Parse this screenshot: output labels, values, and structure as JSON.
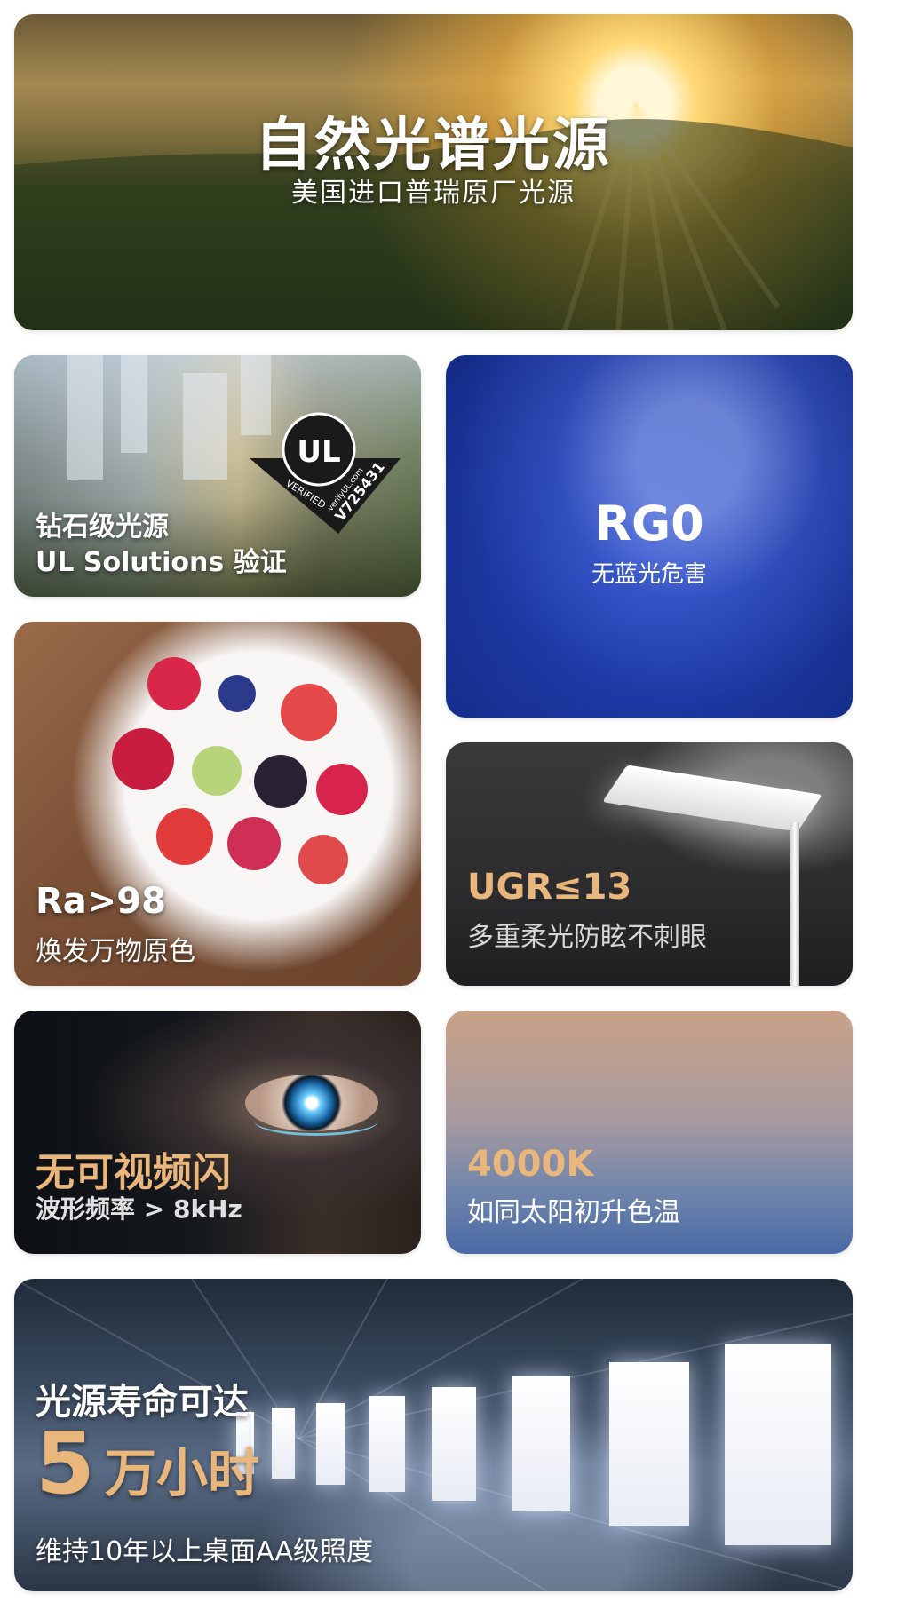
{
  "cards": {
    "spectrum": {
      "title": "自然光谱光源",
      "subtitle": "美国进口普瑞原厂光源"
    },
    "ul": {
      "title": "钻石级光源",
      "subtitle": "UL Solutions 验证",
      "badge": {
        "mark": "UL",
        "verified": "VERIFIED",
        "site": "verifyUL.com",
        "code": "V725431"
      }
    },
    "rg0": {
      "title": "RG0",
      "subtitle": "无蓝光危害"
    },
    "ra": {
      "title": "Ra>98",
      "subtitle": "焕发万物原色"
    },
    "ugr": {
      "title": "UGR≤13",
      "subtitle": "多重柔光防眩不刺眼"
    },
    "flicker": {
      "title": "无可视频闪",
      "subtitle": "波形频率 > 8kHz"
    },
    "cct": {
      "title": "4000K",
      "subtitle": "如同太阳初升色温"
    },
    "life": {
      "title": "光源寿命可达",
      "big_number": "5",
      "big_unit": "万小时",
      "subtitle": "维持10年以上桌面AA级照度"
    }
  },
  "colors": {
    "accent_gold": "#e9b67c",
    "rg0_blue": "#1d3aa6",
    "text_white": "#ffffff"
  },
  "icons": [
    "ul-verified-badge-icon"
  ]
}
